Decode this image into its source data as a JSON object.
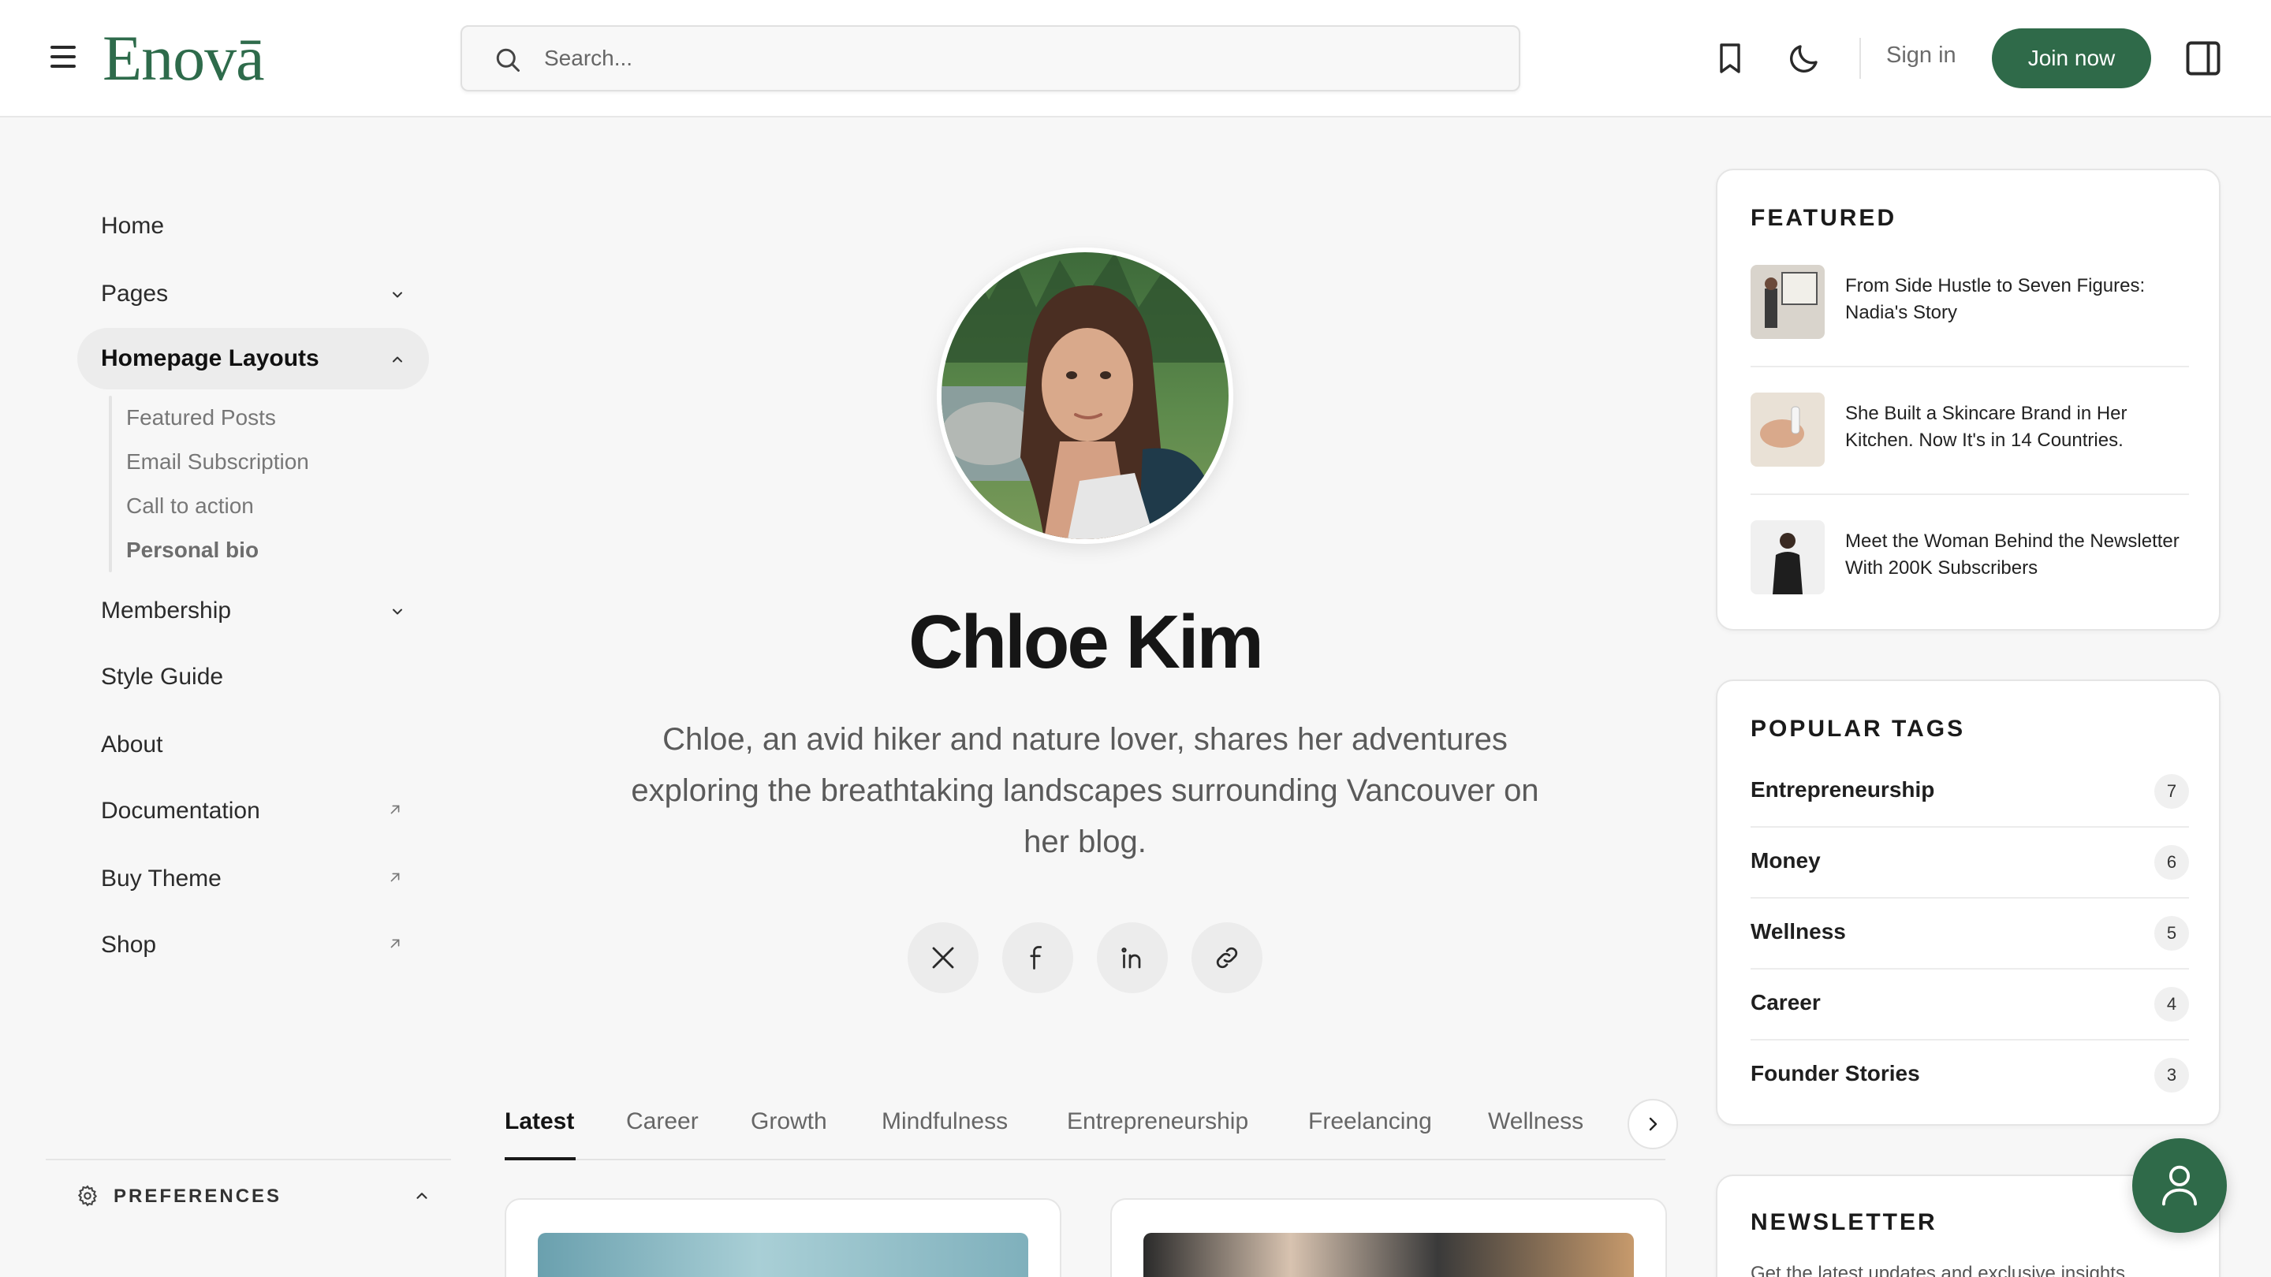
{
  "header": {
    "logo": "Enovā",
    "search_placeholder": "Search...",
    "signin_label": "Sign in",
    "join_label": "Join now",
    "icons": [
      "menu-icon",
      "search-icon",
      "bookmark-icon",
      "moon-icon",
      "sidebar-toggle-icon"
    ]
  },
  "sidebar": {
    "items": [
      {
        "label": "Home"
      },
      {
        "label": "Pages"
      },
      {
        "label": "Homepage Layouts"
      },
      {
        "label": "Membership"
      },
      {
        "label": "Style Guide"
      },
      {
        "label": "About"
      },
      {
        "label": "Documentation"
      },
      {
        "label": "Buy Theme"
      },
      {
        "label": "Shop"
      }
    ],
    "subitems": [
      {
        "label": "Featured Posts"
      },
      {
        "label": "Email Subscription"
      },
      {
        "label": "Call to action"
      },
      {
        "label": "Personal bio"
      }
    ],
    "preferences_label": "PREFERENCES"
  },
  "profile": {
    "name": "Chloe Kim",
    "bio": "Chloe, an avid hiker and nature lover, shares her adventures exploring the breathtaking landscapes surrounding Vancouver on her blog.",
    "socials": [
      "x-icon",
      "facebook-icon",
      "linkedin-icon",
      "link-icon"
    ]
  },
  "tabs": [
    {
      "label": "Latest"
    },
    {
      "label": "Career"
    },
    {
      "label": "Growth"
    },
    {
      "label": "Mindfulness"
    },
    {
      "label": "Entrepreneurship"
    },
    {
      "label": "Freelancing"
    },
    {
      "label": "Wellness"
    }
  ],
  "featured": {
    "title": "FEATURED",
    "items": [
      {
        "title": "From Side Hustle to Seven Figures: Nadia's Story"
      },
      {
        "title": "She Built a Skincare Brand in Her Kitchen. Now It's in 14 Countries."
      },
      {
        "title": "Meet the Woman Behind the Newsletter With 200K Subscribers"
      }
    ]
  },
  "popular_tags": {
    "title": "POPULAR TAGS",
    "items": [
      {
        "name": "Entrepreneurship",
        "count": "7"
      },
      {
        "name": "Money",
        "count": "6"
      },
      {
        "name": "Wellness",
        "count": "5"
      },
      {
        "name": "Career",
        "count": "4"
      },
      {
        "name": "Founder Stories",
        "count": "3"
      }
    ]
  },
  "newsletter": {
    "title": "NEWSLETTER",
    "subtitle": "Get the latest updates and exclusive insights"
  },
  "colors": {
    "brand": "#2f6a49",
    "background": "#f7f7f7",
    "panel": "#ffffff"
  }
}
